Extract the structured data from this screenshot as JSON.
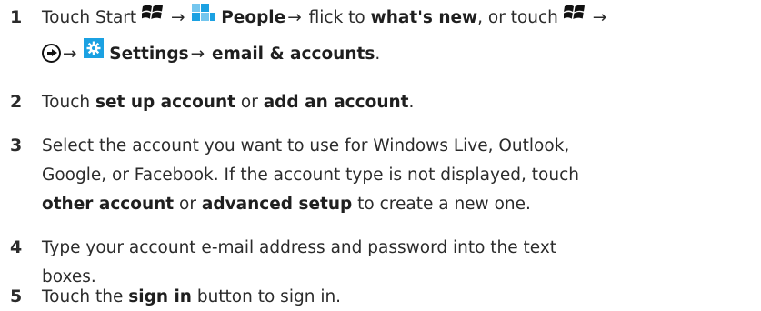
{
  "steps": [
    {
      "number": "1",
      "line1": {
        "t1": "Touch Start",
        "arrow1": "→",
        "people": "People",
        "arrow2": "→",
        "t2": " flick to ",
        "whats_new": "what's new",
        "t3": ", or touch",
        "arrow3": "→"
      },
      "line2": {
        "arrow1": "→",
        "settings": "Settings",
        "arrow2": "→",
        "t1": " ",
        "email_accounts": "email & accounts",
        "t2": "."
      }
    },
    {
      "number": "2",
      "t1": "Touch ",
      "b1": "set up account",
      "t2": " or ",
      "b2": "add an account",
      "t3": "."
    },
    {
      "number": "3",
      "line1": "Select the account you want to use for Windows Live, Outlook,",
      "line2": "Google, or Facebook. If the account type is not displayed, touch",
      "line3": {
        "b1": "other account",
        "t1": " or ",
        "b2": "advanced setup",
        "t2": " to create a new one."
      }
    },
    {
      "number": "4",
      "line1": "Type your account e-mail address and password into the text",
      "line2": "boxes."
    },
    {
      "number": "5",
      "t1": "Touch the ",
      "b1": "sign in",
      "t2": " button to sign in."
    }
  ],
  "icons": {
    "windows": "windows-logo-icon",
    "people": "people-tile-icon",
    "arrow_circle": "arrow-circle-icon",
    "settings": "settings-tile-icon"
  },
  "colors": {
    "text": "#2b2b2b",
    "tile_blue": "#1ba1e2",
    "tile_light_blue": "#74c6ee"
  }
}
